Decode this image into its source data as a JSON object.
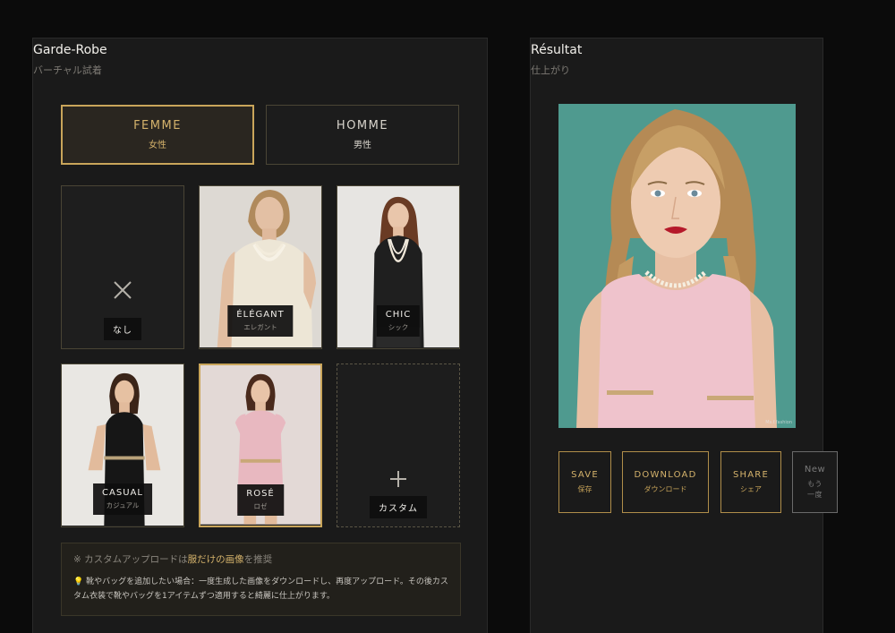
{
  "left_panel": {
    "title": "Garde-Robe",
    "subtitle": "バーチャル試着",
    "gender": {
      "femme": {
        "en": "FEMME",
        "ja": "女性"
      },
      "homme": {
        "en": "HOMME",
        "ja": "男性"
      },
      "selected": "femme"
    },
    "outfits": [
      {
        "id": "none",
        "en": "なし",
        "ja": "",
        "icon": "close-x-icon"
      },
      {
        "id": "elegant",
        "en": "ÉLÉGANT",
        "ja": "エレガント"
      },
      {
        "id": "chic",
        "en": "CHIC",
        "ja": "シック"
      },
      {
        "id": "casual",
        "en": "CASUAL",
        "ja": "カジュアル"
      },
      {
        "id": "rose",
        "en": "ROSÉ",
        "ja": "ロゼ",
        "selected": true
      },
      {
        "id": "custom",
        "en": "カスタム",
        "ja": "",
        "icon": "plus-icon"
      }
    ],
    "note": {
      "prefix": "※ カスタムアップロードは",
      "highlight": "服だけの画像",
      "suffix": "を推奨",
      "tip_icon": "lightbulb-icon",
      "tip": "靴やバッグを追加したい場合：一度生成した画像をダウンロードし、再度アップロード。その後カスタム衣装で靴やバッグを1アイテムずつ適用すると綺麗に仕上がります。"
    }
  },
  "right_panel": {
    "title": "Résultat",
    "subtitle": "仕上がり",
    "watermark": "Ms.f.fashion",
    "actions": [
      {
        "en": "SAVE",
        "ja": "保存"
      },
      {
        "en": "DOWNLOAD",
        "ja": "ダウンロード"
      },
      {
        "en": "SHARE",
        "ja": "シェア"
      },
      {
        "en": "New",
        "ja": "もう一度"
      }
    ]
  },
  "colors": {
    "accent_gold": "#c9a55a",
    "panel_bg": "#1a1a1a",
    "page_bg": "#0b0b0b",
    "result_bg": "#4f9a8f"
  }
}
